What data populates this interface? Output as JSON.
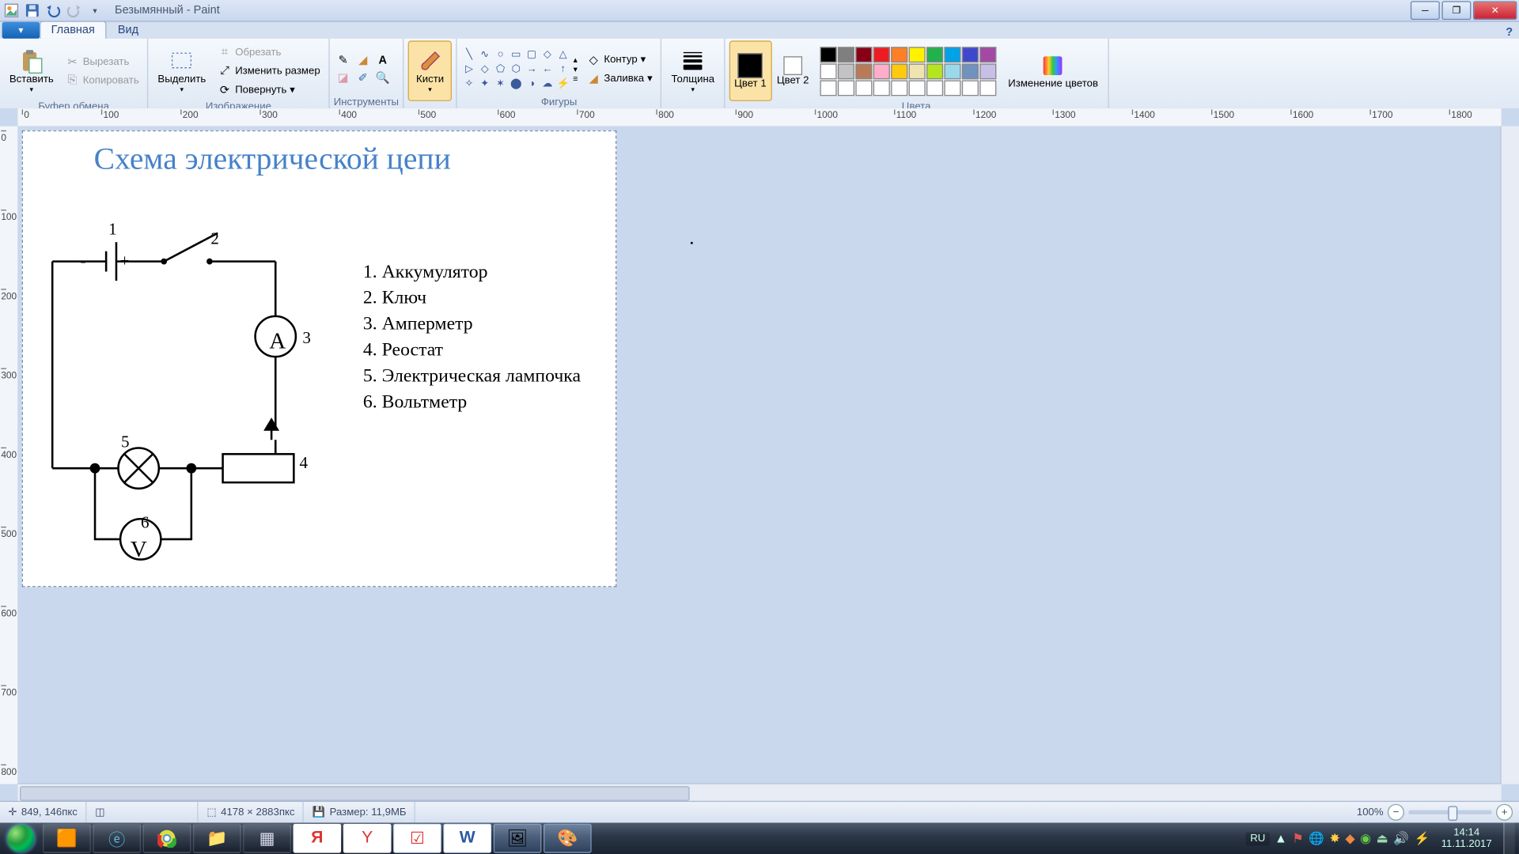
{
  "titlebar": {
    "document": "Безымянный",
    "app": "Paint"
  },
  "tabs": {
    "home": "Главная",
    "view": "Вид"
  },
  "clipboard": {
    "group": "Буфер обмена",
    "paste": "Вставить",
    "cut": "Вырезать",
    "copy": "Копировать"
  },
  "image": {
    "group": "Изображение",
    "select": "Выделить",
    "crop": "Обрезать",
    "resize": "Изменить размер",
    "rotate": "Повернуть"
  },
  "tools": {
    "group": "Инструменты"
  },
  "brush": {
    "label": "Кисти"
  },
  "shapes": {
    "group": "Фигуры",
    "outline": "Контур",
    "fill": "Заливка"
  },
  "size": {
    "label": "Толщина"
  },
  "colors": {
    "group": "Цвета",
    "c1": "Цвет 1",
    "c2": "Цвет 2",
    "edit": "Изменение цветов",
    "c1_value": "#000000",
    "c2_value": "#ffffff",
    "palette": [
      "#000000",
      "#7f7f7f",
      "#880015",
      "#ed1c24",
      "#ff7f27",
      "#fff200",
      "#22b14c",
      "#00a2e8",
      "#3f48cc",
      "#a349a4",
      "#ffffff",
      "#c3c3c3",
      "#b97a57",
      "#ffaec9",
      "#ffc90e",
      "#efe4b0",
      "#b5e61d",
      "#99d9ea",
      "#7092be",
      "#c8bfe7",
      "#ffffff",
      "#ffffff",
      "#ffffff",
      "#ffffff",
      "#ffffff",
      "#ffffff",
      "#ffffff",
      "#ffffff",
      "#ffffff",
      "#ffffff"
    ]
  },
  "ruler_h": [
    "0",
    "100",
    "200",
    "300",
    "400",
    "500",
    "600",
    "700",
    "800",
    "900",
    "1000",
    "1100",
    "1200",
    "1300",
    "1400",
    "1500",
    "1600",
    "1700",
    "1800"
  ],
  "ruler_v": [
    "0",
    "100",
    "200",
    "300",
    "400",
    "500",
    "600",
    "700",
    "800"
  ],
  "canvas": {
    "title": "Схема электрической цепи",
    "num1": "1",
    "num2": "2",
    "num3": "3",
    "num4": "4",
    "num5": "5",
    "num6": "6",
    "minus": "-",
    "plus": "+",
    "A": "А",
    "V": "V",
    "legend": [
      "1. Аккумулятор",
      "2. Ключ",
      "3. Амперметр",
      "4. Реостат",
      "5. Электрическая лампочка",
      "6. Вольтметр"
    ]
  },
  "status": {
    "pos": "849, 146пкс",
    "dim": "4178 × 2883пкс",
    "size": "Размер: 11,9МБ",
    "zoom": "100%"
  },
  "tray": {
    "lang": "RU",
    "time": "14:14",
    "date": "11.11.2017"
  }
}
